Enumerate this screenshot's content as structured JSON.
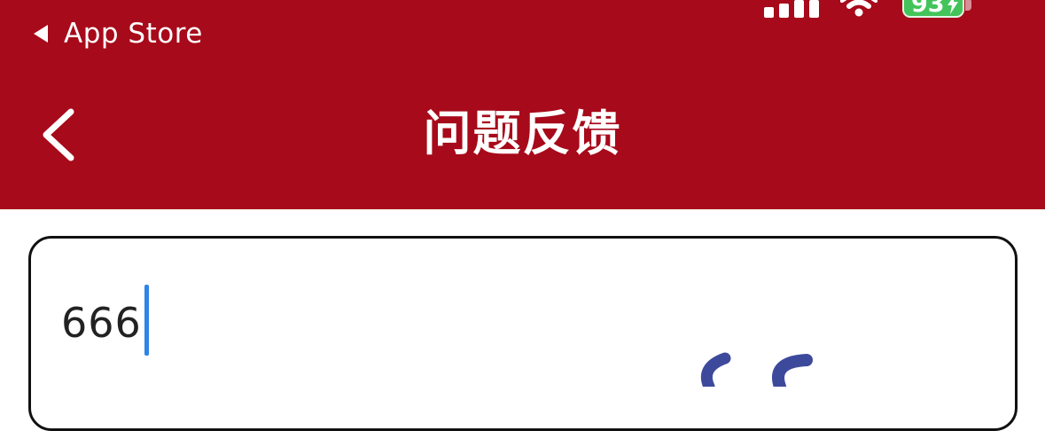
{
  "status_bar": {
    "back_app_label": "App Store",
    "battery_level": "93",
    "battery_color": "#43c45a",
    "icons": [
      "cellular-signal-icon",
      "wifi-icon",
      "battery-icon"
    ]
  },
  "nav": {
    "title": "问题反馈",
    "back_icon": "chevron-left-icon",
    "background": "#a70a1a"
  },
  "feedback": {
    "input_value": "666",
    "caret_color": "#2f84e6"
  }
}
